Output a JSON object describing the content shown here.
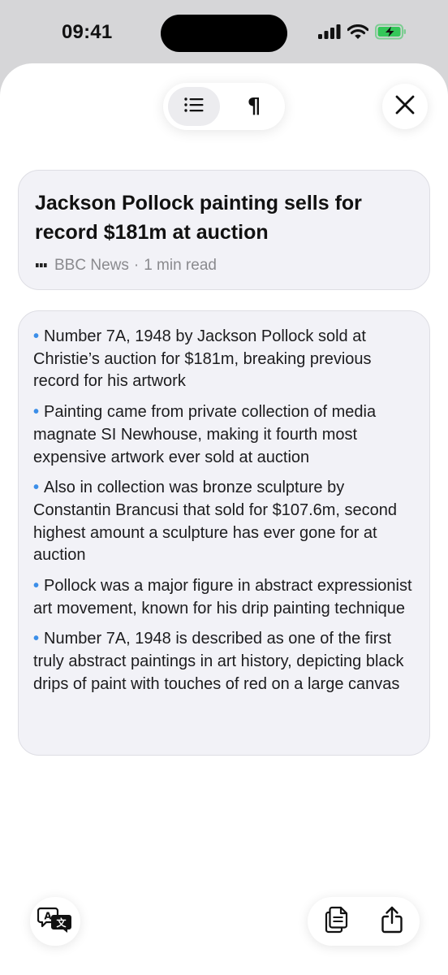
{
  "status_bar": {
    "time": "09:41",
    "battery_color": "#34c759"
  },
  "toolbar": {
    "summary_mode_icon": "list-icon",
    "paragraph_mode_icon": "pilcrow-icon",
    "paragraph_glyph": "¶",
    "close_icon": "close-icon"
  },
  "article": {
    "title": "Jackson Pollock painting sells for record $181m at auction",
    "source": "BBC News",
    "separator": "·",
    "read_time": "1 min read"
  },
  "summary": {
    "bullet_glyph": "•",
    "bullet_color": "#3b8ee8",
    "bullets": [
      "Number 7A, 1948 by Jackson Pollock sold at Christie’s auction for $181m, breaking previous record for his artwork",
      "Painting came from private collection of media magnate SI Newhouse, making it fourth most expensive artwork ever sold at auction",
      "Also in collection was bronze sculpture by Constantin Brancusi that sold for $107.6m, second highest amount a sculpture has ever gone for at auction",
      "Pollock was a major figure in abstract expressionist art movement, known for his drip painting technique",
      "Number 7A, 1948 is described as one of the first truly abstract paintings in art history, depicting black drips of paint with touches of red on a large canvas"
    ]
  },
  "bottom_bar": {
    "translate_icon": "translate-icon",
    "copy_icon": "copy-icon",
    "share_icon": "share-icon"
  }
}
